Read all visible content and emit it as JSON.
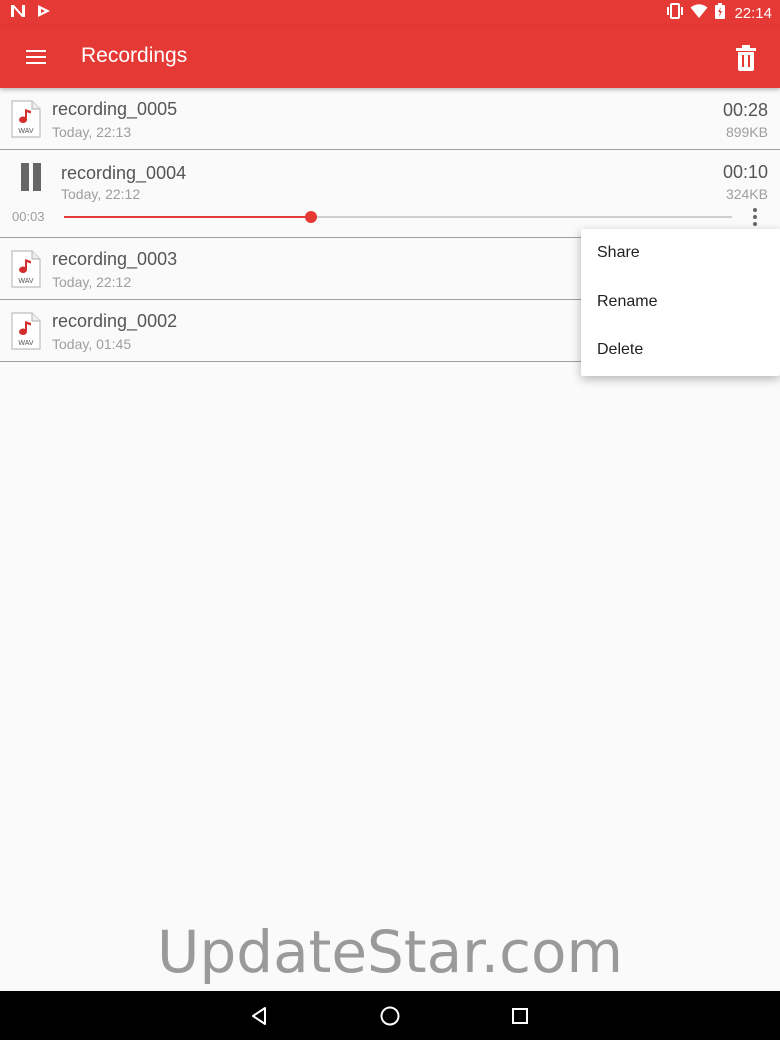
{
  "status_bar": {
    "time": "22:14",
    "left_icons": [
      "n-notification-icon",
      "play-store-notification-icon"
    ],
    "right_icons": [
      "vibrate-icon",
      "wifi-icon",
      "battery-icon"
    ]
  },
  "app_bar": {
    "title": "Recordings",
    "menu_icon": "hamburger-menu-icon",
    "delete_icon": "trash-icon",
    "color": "#e53935"
  },
  "recordings": [
    {
      "name": "recording_0005",
      "date": "Today, 22:13",
      "duration": "00:28",
      "size": "899KB",
      "file_type": "WAV"
    },
    {
      "name": "recording_0004",
      "date": "Today, 22:12",
      "duration": "00:10",
      "size": "324KB",
      "file_type": "WAV"
    },
    {
      "name": "recording_0003",
      "date": "Today, 22:12",
      "duration": "",
      "size": "",
      "file_type": "WAV"
    },
    {
      "name": "recording_0002",
      "date": "Today, 01:45",
      "duration": "",
      "size": "",
      "file_type": "WAV"
    }
  ],
  "player": {
    "elapsed": "00:03",
    "progress": 0.37,
    "state": "playing",
    "pause_icon": "pause-icon",
    "more_icon": "more-vert-icon"
  },
  "popup_menu": {
    "items": [
      "Share",
      "Rename",
      "Delete"
    ]
  },
  "watermark": "UpdateStar.com",
  "nav_bar": {
    "icons": [
      "back-icon",
      "home-icon",
      "recents-icon"
    ]
  }
}
